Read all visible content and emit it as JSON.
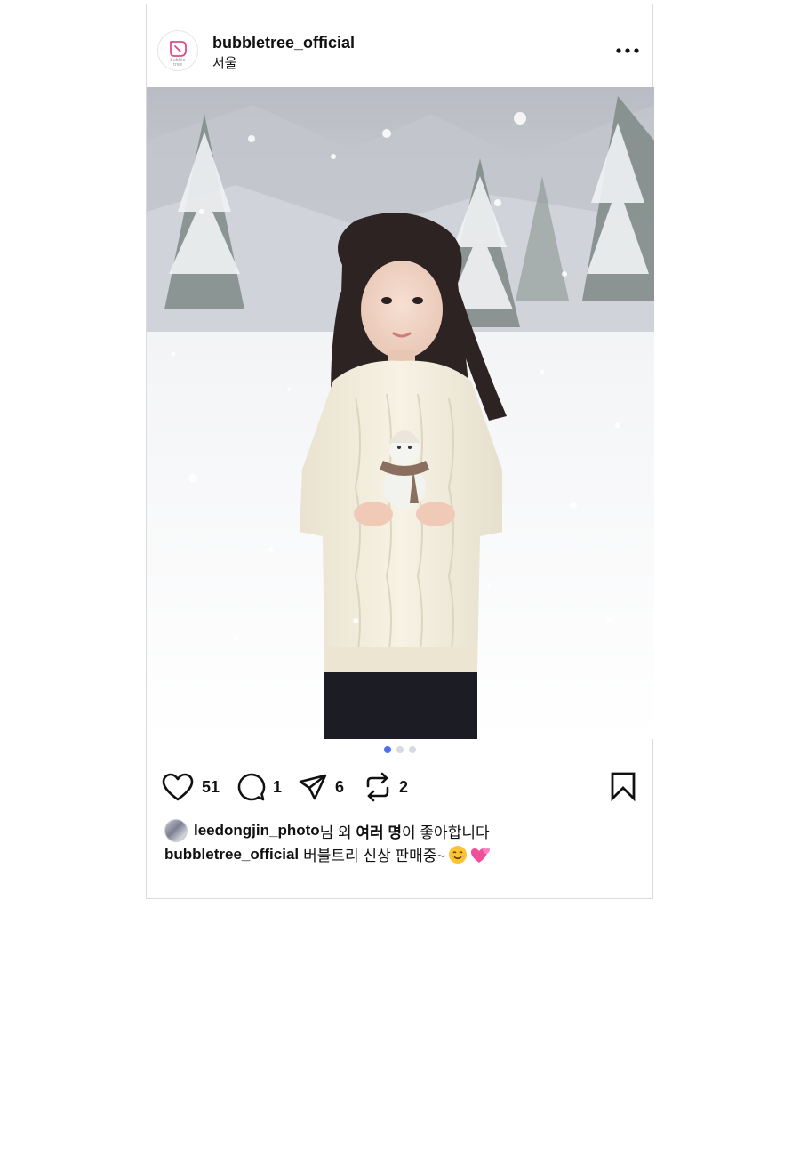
{
  "post": {
    "username": "bubbletree_official",
    "location": "서울",
    "avatar_logo_text": "bubble tree",
    "carousel": {
      "count": 3,
      "active_index": 0
    },
    "actions": {
      "likes": "51",
      "comments": "1",
      "shares": "6",
      "reposts": "2"
    },
    "liked_by": {
      "user": "leedongjin_photo",
      "middle": "님 외 ",
      "others": "여러 명",
      "suffix": "이 좋아합니다"
    },
    "caption": {
      "user": "bubbletree_official",
      "text": "버블트리 신상 판매중~"
    }
  },
  "colors": {
    "accent_dot": "#4f6ff0",
    "logo_pink": "#e04b86",
    "border": "#dbdbdb"
  },
  "icons": [
    "more-icon",
    "heart-icon",
    "comment-icon",
    "share-icon",
    "repost-icon",
    "bookmark-icon",
    "smile-emoji",
    "two-hearts-emoji"
  ]
}
